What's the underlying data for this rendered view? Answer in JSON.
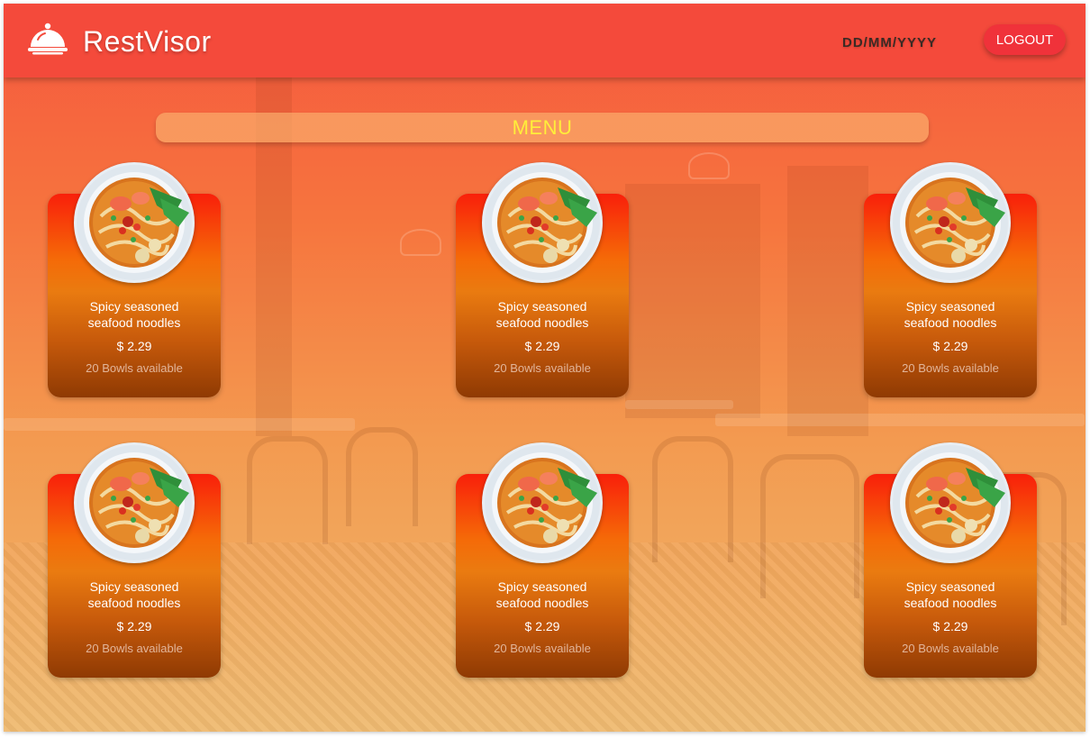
{
  "header": {
    "app_title": "RestVisor",
    "date": "DD/MM/YYYY",
    "logout_label": "LOGOUT"
  },
  "menu": {
    "title": "MENU",
    "items": [
      {
        "name_line1": "Spicy seasoned",
        "name_line2": "seafood noodles",
        "price": "$ 2.29",
        "availability": "20 Bowls available"
      },
      {
        "name_line1": "Spicy seasoned",
        "name_line2": "seafood noodles",
        "price": "$ 2.29",
        "availability": "20 Bowls available"
      },
      {
        "name_line1": "Spicy seasoned",
        "name_line2": "seafood noodles",
        "price": "$ 2.29",
        "availability": "20 Bowls available"
      },
      {
        "name_line1": "Spicy seasoned",
        "name_line2": "seafood noodles",
        "price": "$ 2.29",
        "availability": "20 Bowls available"
      },
      {
        "name_line1": "Spicy seasoned",
        "name_line2": "seafood noodles",
        "price": "$ 2.29",
        "availability": "20 Bowls available"
      },
      {
        "name_line1": "Spicy seasoned",
        "name_line2": "seafood noodles",
        "price": "$ 2.29",
        "availability": "20 Bowls available"
      }
    ]
  },
  "icons": {
    "logo": "serving-cloche-icon",
    "dish_image": "noodle-bowl-image"
  },
  "colors": {
    "header": "#f44a3b",
    "logout_button": "#f0323a",
    "menu_title": "#ffee3a"
  }
}
